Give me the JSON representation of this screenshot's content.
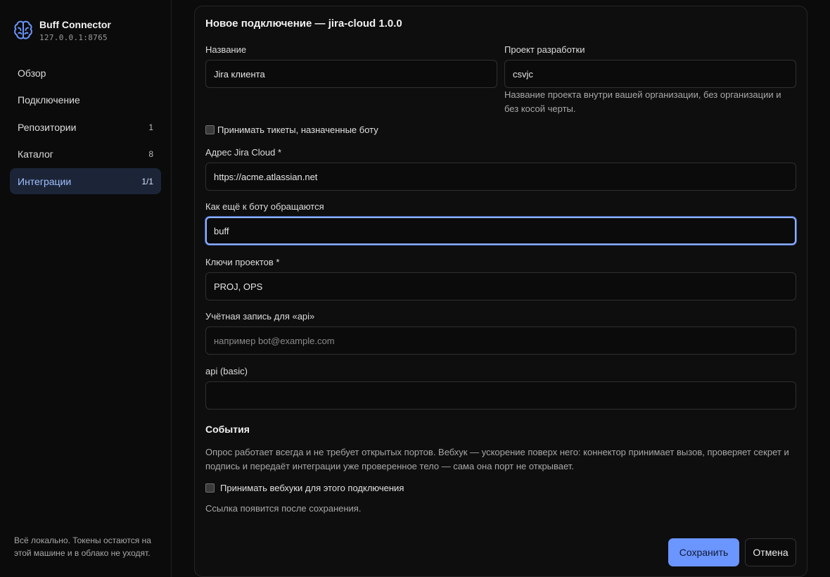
{
  "brand": {
    "title": "Buff Connector",
    "address": "127.0.0.1:8765",
    "icon": "brain-icon",
    "accent": "#6b95ff"
  },
  "nav": {
    "items": [
      {
        "label": "Обзор",
        "count": ""
      },
      {
        "label": "Подключение",
        "count": ""
      },
      {
        "label": "Репозитории",
        "count": "1"
      },
      {
        "label": "Каталог",
        "count": "8"
      },
      {
        "label": "Интеграции",
        "count": "1/1",
        "active": true
      }
    ]
  },
  "sidebar_footer": "Всё локально. Токены остаются на этой машине и в облако не уходят.",
  "form": {
    "title": "Новое подключение — jira-cloud 1.0.0",
    "name": {
      "label": "Название",
      "value": "Jira клиента"
    },
    "project": {
      "label": "Проект разработки",
      "value": "csvjc",
      "hint": "Название проекта внутри вашей организации, без организации и без косой черты."
    },
    "accept_assigned": {
      "label": "Принимать тикеты, назначенные боту",
      "checked": false
    },
    "jira_url": {
      "label": "Адрес Jira Cloud *",
      "value": "https://acme.atlassian.net"
    },
    "aliases": {
      "label": "Как ещё к боту обращаются",
      "value": "buff"
    },
    "project_keys": {
      "label": "Ключи проектов *",
      "value": "PROJ, OPS"
    },
    "account": {
      "label": "Учётная запись для «api»",
      "value": "",
      "placeholder": "например bot@example.com"
    },
    "api_basic": {
      "label": "api (basic)",
      "value": ""
    },
    "events": {
      "title": "События",
      "description": "Опрос работает всегда и не требует открытых портов. Вебхук — ускорение поверх него: коннектор принимает вызов, проверяет секрет и подпись и передаёт интеграции уже проверенное тело — сама она порт не открывает.",
      "webhook_label": "Принимать вебхуки для этого подключения",
      "webhook_checked": false,
      "link_note": "Ссылка появится после сохранения."
    },
    "save_label": "Сохранить",
    "cancel_label": "Отмена"
  }
}
